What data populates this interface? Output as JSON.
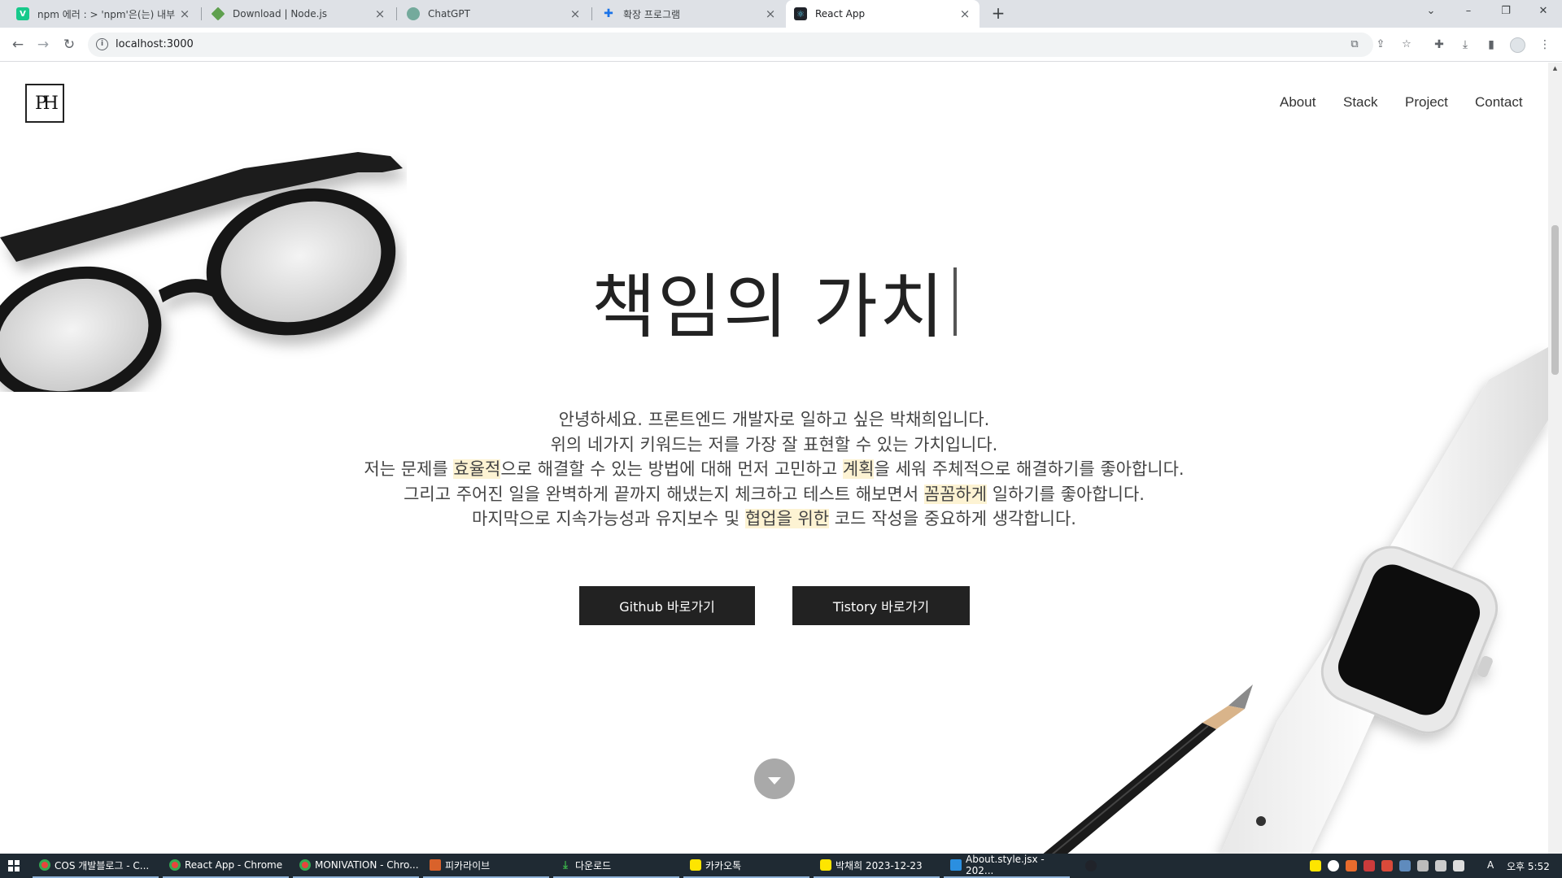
{
  "browser": {
    "tabs": [
      {
        "label": "npm 에러 : > 'npm'은(는) 내부",
        "icon": "v-favicon-icon",
        "color": "#17c98b",
        "glyph": "V"
      },
      {
        "label": "Download | Node.js",
        "icon": "nodejs-favicon-icon",
        "color": "#5fa04e",
        "glyph": ""
      },
      {
        "label": "ChatGPT",
        "icon": "chatgpt-favicon-icon",
        "color": "#74aa9c",
        "glyph": ""
      },
      {
        "label": "확장 프로그램",
        "icon": "puzzle-favicon-icon",
        "color": "#1a73e8",
        "glyph": ""
      },
      {
        "label": "React App",
        "icon": "react-favicon-icon",
        "color": "#20232a",
        "glyph": ""
      }
    ],
    "active_tab": 4,
    "new_tab_glyph": "+",
    "close_glyph": "×",
    "url": "localhost:3000",
    "info_glyph": "i",
    "window_controls": {
      "search": "⌄",
      "minimize": "–",
      "restore": "❐",
      "close": "✕"
    }
  },
  "site": {
    "logo_text": "PH",
    "nav": [
      "About",
      "Stack",
      "Project",
      "Contact"
    ],
    "hero_title": "책임의 가치",
    "intro": {
      "line1": "안녕하세요. 프론트엔드 개발자로 일하고 싶은 박채희입니다.",
      "line2": "위의 네가지 키워드는 저를 가장 잘 표현할 수 있는 가치입니다.",
      "line3": [
        {
          "t": "저는 문제를 ",
          "hl": false
        },
        {
          "t": "효율적",
          "hl": true
        },
        {
          "t": "으로 해결할 수 있는 방법에 대해 먼저 고민하고 ",
          "hl": false
        },
        {
          "t": "계획",
          "hl": true
        },
        {
          "t": "을 세워 주체적으로 해결하기를 좋아합니다.",
          "hl": false
        }
      ],
      "line4": [
        {
          "t": "그리고 주어진 일을 완벽하게 끝까지 해냈는지 체크하고 테스트 해보면서 ",
          "hl": false
        },
        {
          "t": "꼼꼼하게",
          "hl": true
        },
        {
          "t": " 일하기를 좋아합니다.",
          "hl": false
        }
      ],
      "line5": [
        {
          "t": "마지막으로 지속가능성과 유지보수 및 ",
          "hl": false
        },
        {
          "t": "협업을 위한",
          "hl": true
        },
        {
          "t": " 코드 작성을 중요하게 생각합니다.",
          "hl": false
        }
      ]
    },
    "buttons": {
      "github": "Github 바로가기",
      "tistory": "Tistory 바로가기"
    },
    "highlight_color": "#fdf3d3"
  },
  "taskbar": {
    "apps": [
      {
        "label": "COS 개발블로그 - C...",
        "color": "#e8453c"
      },
      {
        "label": "React App - Chrome",
        "color": "#e8453c"
      },
      {
        "label": "MONIVATION - Chro...",
        "color": "#e8453c"
      },
      {
        "label": "피카라이브",
        "color": "#d9622b"
      },
      {
        "label": "다운로드",
        "color": "#3bb24a"
      },
      {
        "label": "카카오톡",
        "color": "#fee500"
      },
      {
        "label": "박채희 2023-12-23",
        "color": "#fee500"
      },
      {
        "label": "About.style.jsx - 202...",
        "color": "#2b8fe0"
      }
    ],
    "ime": "A",
    "clock": "오후 5:52"
  }
}
